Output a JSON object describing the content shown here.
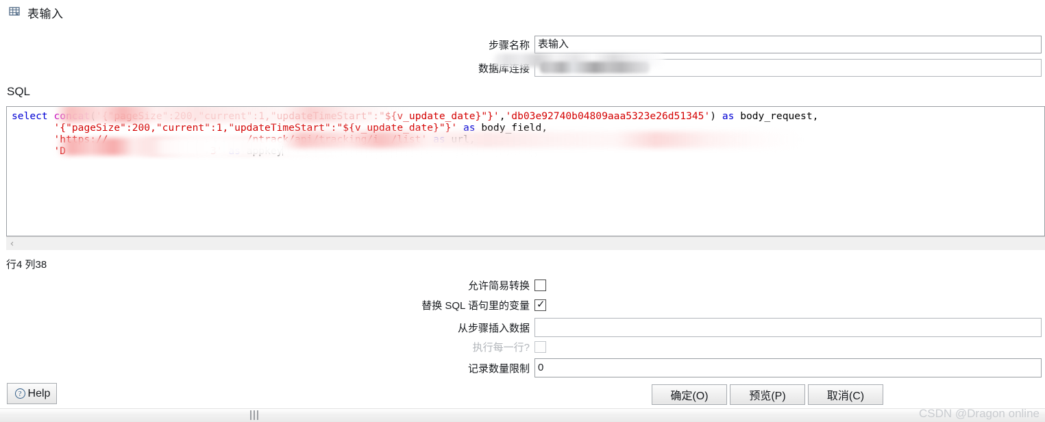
{
  "window": {
    "title": "表输入",
    "icon": "table-input-icon"
  },
  "form": {
    "step_name_label": "步骤名称",
    "step_name_value": "表输入",
    "connection_label": "数据库连接",
    "connection_value": "",
    "connection_redacted": true
  },
  "sql": {
    "section_label": "SQL",
    "lines": [
      {
        "segments": [
          {
            "t": "select ",
            "c": "kw"
          },
          {
            "t": "concat",
            "c": "fn"
          },
          {
            "t": "(",
            "c": "pln"
          },
          {
            "t": "'{\"pageSize\":200,\"current\":1,\"updateTimeStart\":\"${v_update_date}\"}'",
            "c": "str"
          },
          {
            "t": ",",
            "c": "pln"
          },
          {
            "t": "'db03e92740b04809aaa5323e26d51345'",
            "c": "str"
          },
          {
            "t": ") ",
            "c": "pln"
          },
          {
            "t": "as",
            "c": "kw"
          },
          {
            "t": " body_request,",
            "c": "pln"
          }
        ]
      },
      {
        "segments": [
          {
            "t": "       ",
            "c": "pln"
          },
          {
            "t": "'{\"pageSize\":200,\"current\":1,\"updateTimeStart\":\"${v_update_date}\"}'",
            "c": "str"
          },
          {
            "t": " ",
            "c": "pln"
          },
          {
            "t": "as",
            "c": "kw"
          },
          {
            "t": " body_field,",
            "c": "pln"
          }
        ]
      },
      {
        "segments": [
          {
            "t": "       ",
            "c": "pln"
          },
          {
            "t": "'https://                       /ntrack/api/tracking/i  /list'",
            "c": "str"
          },
          {
            "t": " ",
            "c": "pln"
          },
          {
            "t": "as",
            "c": "kw"
          },
          {
            "t": " url,",
            "c": "pln"
          }
        ]
      },
      {
        "segments": [
          {
            "t": "       ",
            "c": "pln"
          },
          {
            "t": "'D                        3'",
            "c": "str"
          },
          {
            "t": " ",
            "c": "pln"
          },
          {
            "t": "as",
            "c": "kw"
          },
          {
            "t": " appkey",
            "c": "pln"
          }
        ]
      }
    ],
    "scroll_left_arrow": "‹",
    "status": "行4 列38"
  },
  "options": {
    "allow_lazy_label": "允许简易转换",
    "allow_lazy_checked": false,
    "replace_vars_label": "替换 SQL 语句里的变量",
    "replace_vars_checked": true,
    "insert_from_step_label": "从步骤插入数据",
    "insert_from_step_value": "",
    "execute_each_row_label": "执行每一行?",
    "execute_each_row_checked": false,
    "execute_each_row_disabled": true,
    "limit_label": "记录数量限制",
    "limit_value": "0"
  },
  "buttons": {
    "help": "Help",
    "help_icon": "question-circle-icon",
    "ok": "确定(O)",
    "preview": "预览(P)",
    "cancel": "取消(C)"
  },
  "watermark": "CSDN @Dragon online",
  "colors": {
    "keyword": "#0000d4",
    "function": "#c000c0",
    "string": "#d40000",
    "plain": "#000000",
    "field_border": "#9a9ea3"
  }
}
